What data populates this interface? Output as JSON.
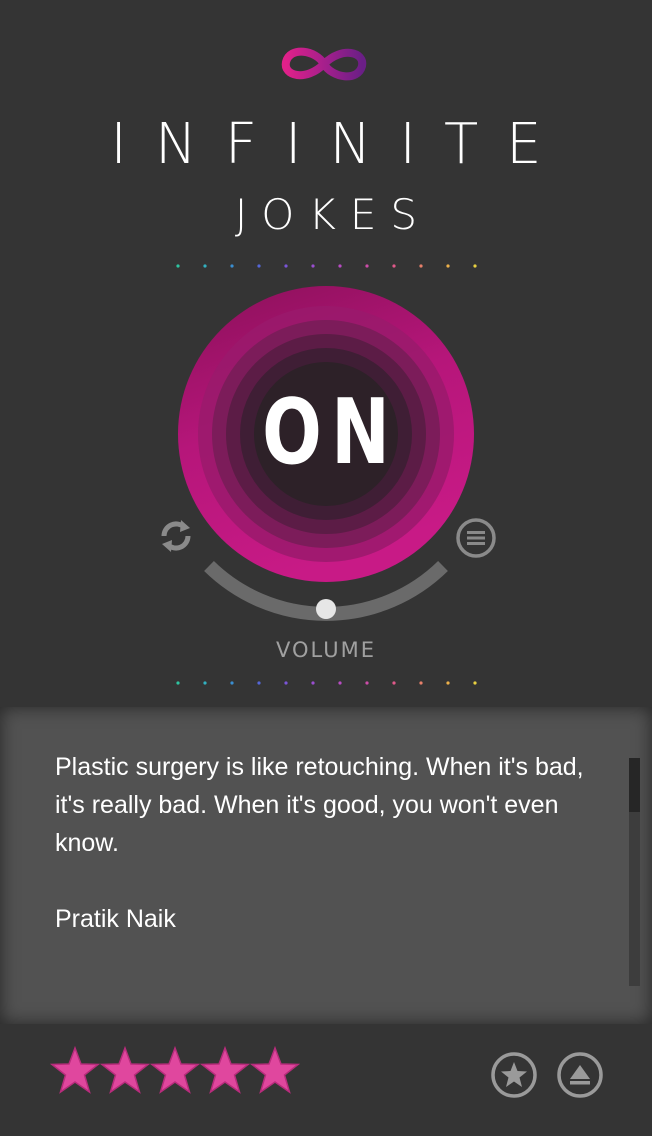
{
  "app": {
    "logo_icon": "infinity-icon",
    "title": "INFINITE",
    "subtitle": "JOKES"
  },
  "player": {
    "state_label": "ON",
    "refresh_icon": "refresh-icon",
    "menu_icon": "list-menu-icon",
    "volume_label": "VOLUME",
    "volume_level": 0.5
  },
  "joke": {
    "text": "Plastic surgery is like retouching. When it's bad, it's really bad. When it's good, you won't even know.",
    "author": "Pratik Naik"
  },
  "rating": {
    "stars": 5,
    "max_stars": 5,
    "star_icon": "star-icon"
  },
  "actions": {
    "favorite_icon": "star-circle-icon",
    "share_icon": "upload-triangle-icon"
  },
  "colors": {
    "background": "#343434",
    "panel": "#525252",
    "accent": "#c4177e",
    "star": "#e0479e",
    "dot_colors": [
      "#2ec4a0",
      "#32b0c0",
      "#3a8ed0",
      "#5566d8",
      "#7a55d8",
      "#9a4ed0",
      "#b84cc4",
      "#cc4da8",
      "#e0598a",
      "#e8806a",
      "#ecb04a",
      "#e8d040"
    ]
  }
}
